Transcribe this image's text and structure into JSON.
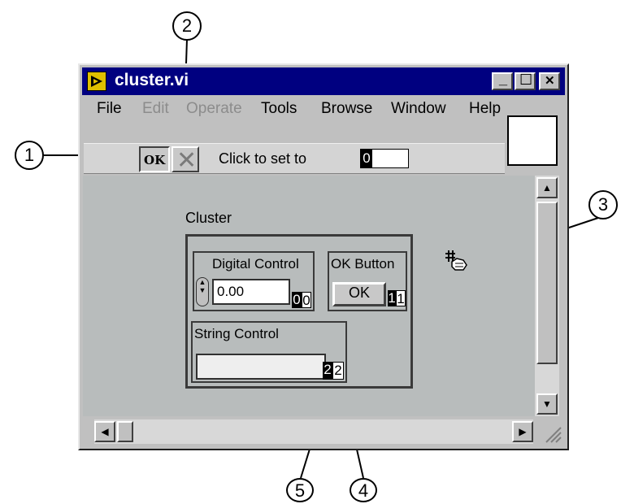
{
  "window": {
    "title": "cluster.vi",
    "minimize_label": "_",
    "maximize_label": "☐",
    "close_label": "✕"
  },
  "menu": {
    "file": "File",
    "edit": "Edit",
    "operate": "Operate",
    "tools": "Tools",
    "browse": "Browse",
    "window": "Window",
    "help": "Help"
  },
  "toolbar": {
    "ok_tool_label": "OK",
    "cancel_tool_label": "✕",
    "click_to_set_text": "Click to set to",
    "set_value": "0"
  },
  "panel": {
    "cluster_label": "Cluster",
    "digital_control_label": "Digital Control",
    "digital_control_value": "0.00",
    "digital_tab_order_new": "0",
    "digital_tab_order_old": "0",
    "ok_button_label": "OK Button",
    "ok_button_text": "OK",
    "ok_tab_order_new": "1",
    "ok_tab_order_old": "1",
    "string_control_label": "String Control",
    "string_tab_order_new": "2",
    "string_tab_order_old": "2"
  },
  "callouts": [
    "1",
    "2",
    "3",
    "4",
    "5"
  ]
}
